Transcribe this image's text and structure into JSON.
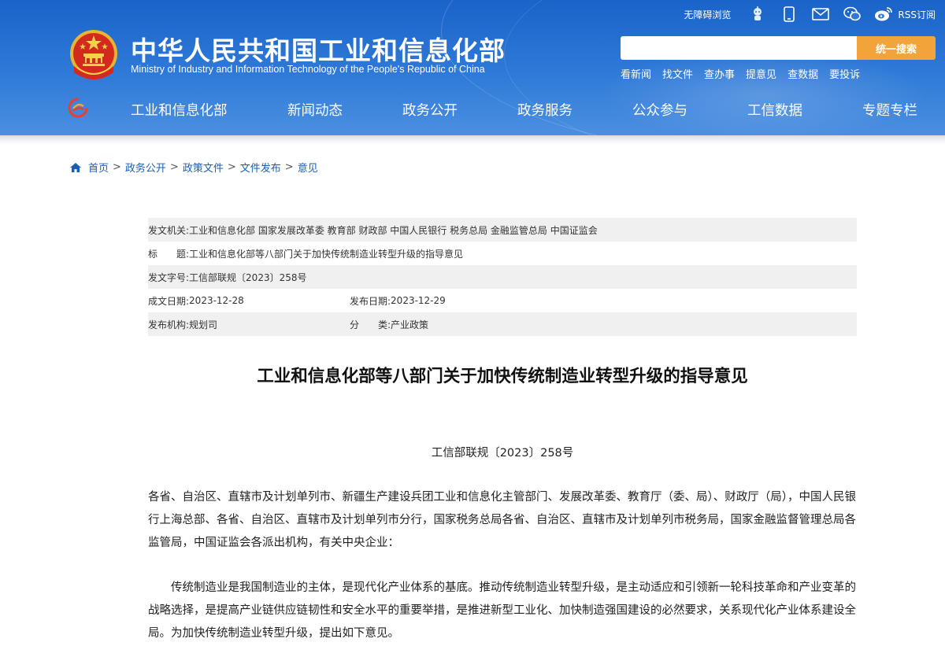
{
  "header": {
    "title": "中华人民共和国工业和信息化部",
    "subtitle": "Ministry of Industry and Information Technology of the People's Republic of China",
    "accessible_label": "无障碍浏览",
    "rss_label": "RSS订阅",
    "search": {
      "placeholder": "",
      "button_label": "统一搜索"
    },
    "quick_links": [
      "看新闻",
      "找文件",
      "查办事",
      "提意见",
      "查数据",
      "要投诉"
    ],
    "nav": [
      "工业和信息化部",
      "新闻动态",
      "政务公开",
      "政务服务",
      "公众参与",
      "工信数据",
      "专题专栏"
    ],
    "colors": {
      "header_blue": "#2f7ad8",
      "search_button": "#f2a33a",
      "link_blue": "#1a5fb4"
    }
  },
  "breadcrumb": [
    "首页",
    "政务公开",
    "政策文件",
    "文件发布",
    "意见"
  ],
  "meta": {
    "issuer_label": "发文机关:",
    "issuer": "工业和信息化部 国家发展改革委 教育部 财政部 中国人民银行 税务总局 金融监管总局 中国证监会",
    "title_label": "标　　题:",
    "title": "工业和信息化部等八部门关于加快传统制造业转型升级的指导意见",
    "doc_no_label": "发文字号:",
    "doc_no": "工信部联规〔2023〕258号",
    "written_label": "成文日期:",
    "written": "2023-12-28",
    "published_label": "发布日期:",
    "published": "2023-12-29",
    "org_label": "发布机构:",
    "org": "规划司",
    "category_label": "分　　类:",
    "category": "产业政策"
  },
  "article": {
    "title": "工业和信息化部等八部门关于加快传统制造业转型升级的指导意见",
    "doc_number": "工信部联规〔2023〕258号",
    "addressees": "各省、自治区、直辖市及计划单列市、新疆生产建设兵团工业和信息化主管部门、发展改革委、教育厅（委、局）、财政厅（局），中国人民银行上海总部、各省、自治区、直辖市及计划单列市分行，国家税务总局各省、自治区、直辖市及计划单列市税务局，国家金融监督管理总局各监管局，中国证监会各派出机构，有关中央企业：",
    "intro": "传统制造业是我国制造业的主体，是现代化产业体系的基底。推动传统制造业转型升级，是主动适应和引领新一轮科技革命和产业变革的战略选择，是提高产业链供应链韧性和安全水平的重要举措，是推进新型工业化、加快制造强国建设的必然要求，关系现代化产业体系建设全局。为加快传统制造业转型升级，提出如下意见。"
  }
}
